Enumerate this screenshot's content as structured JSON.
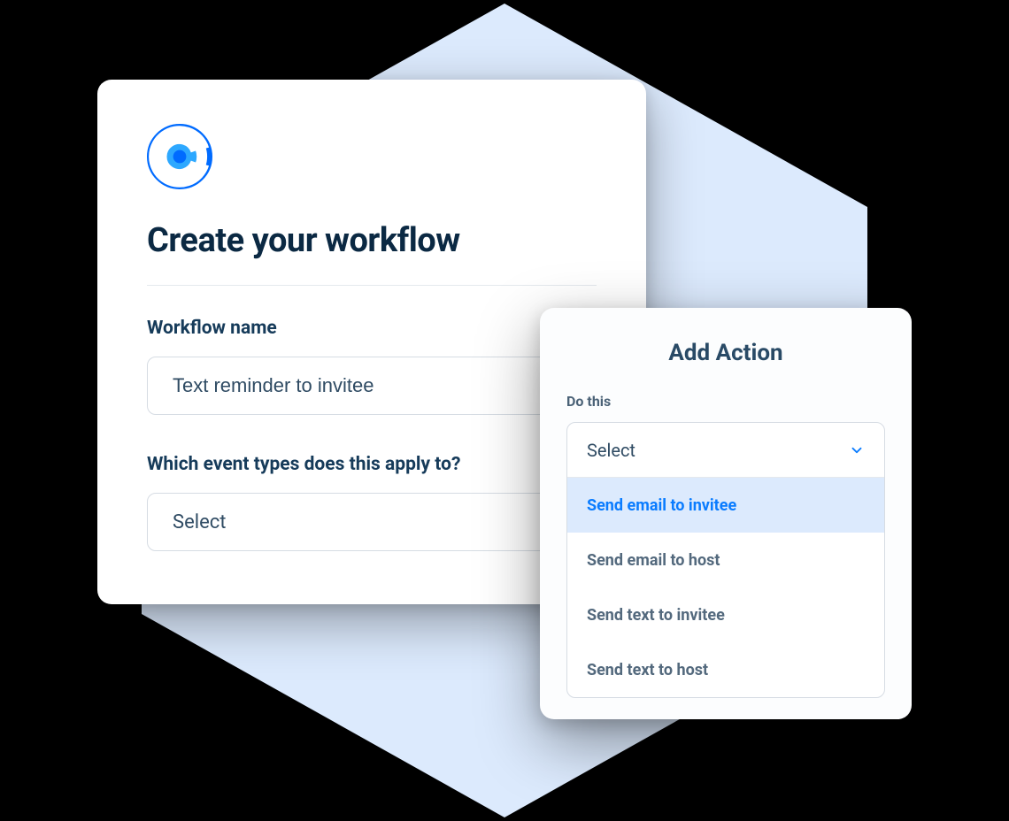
{
  "workflow": {
    "title": "Create your workflow",
    "name_label": "Workflow name",
    "name_value": "Text reminder to invitee",
    "event_types_label": "Which event types does this apply to?",
    "event_types_select_placeholder": "Select"
  },
  "action": {
    "title": "Add Action",
    "do_this_label": "Do this",
    "select_placeholder": "Select",
    "options": [
      "Send email to invitee",
      "Send email to host",
      "Send text to invitee",
      "Send text to host"
    ],
    "highlighted_index": 0
  },
  "colors": {
    "brand_blue": "#006bff",
    "hexagon_bg": "#dceafd",
    "text_dark": "#0b2943"
  }
}
